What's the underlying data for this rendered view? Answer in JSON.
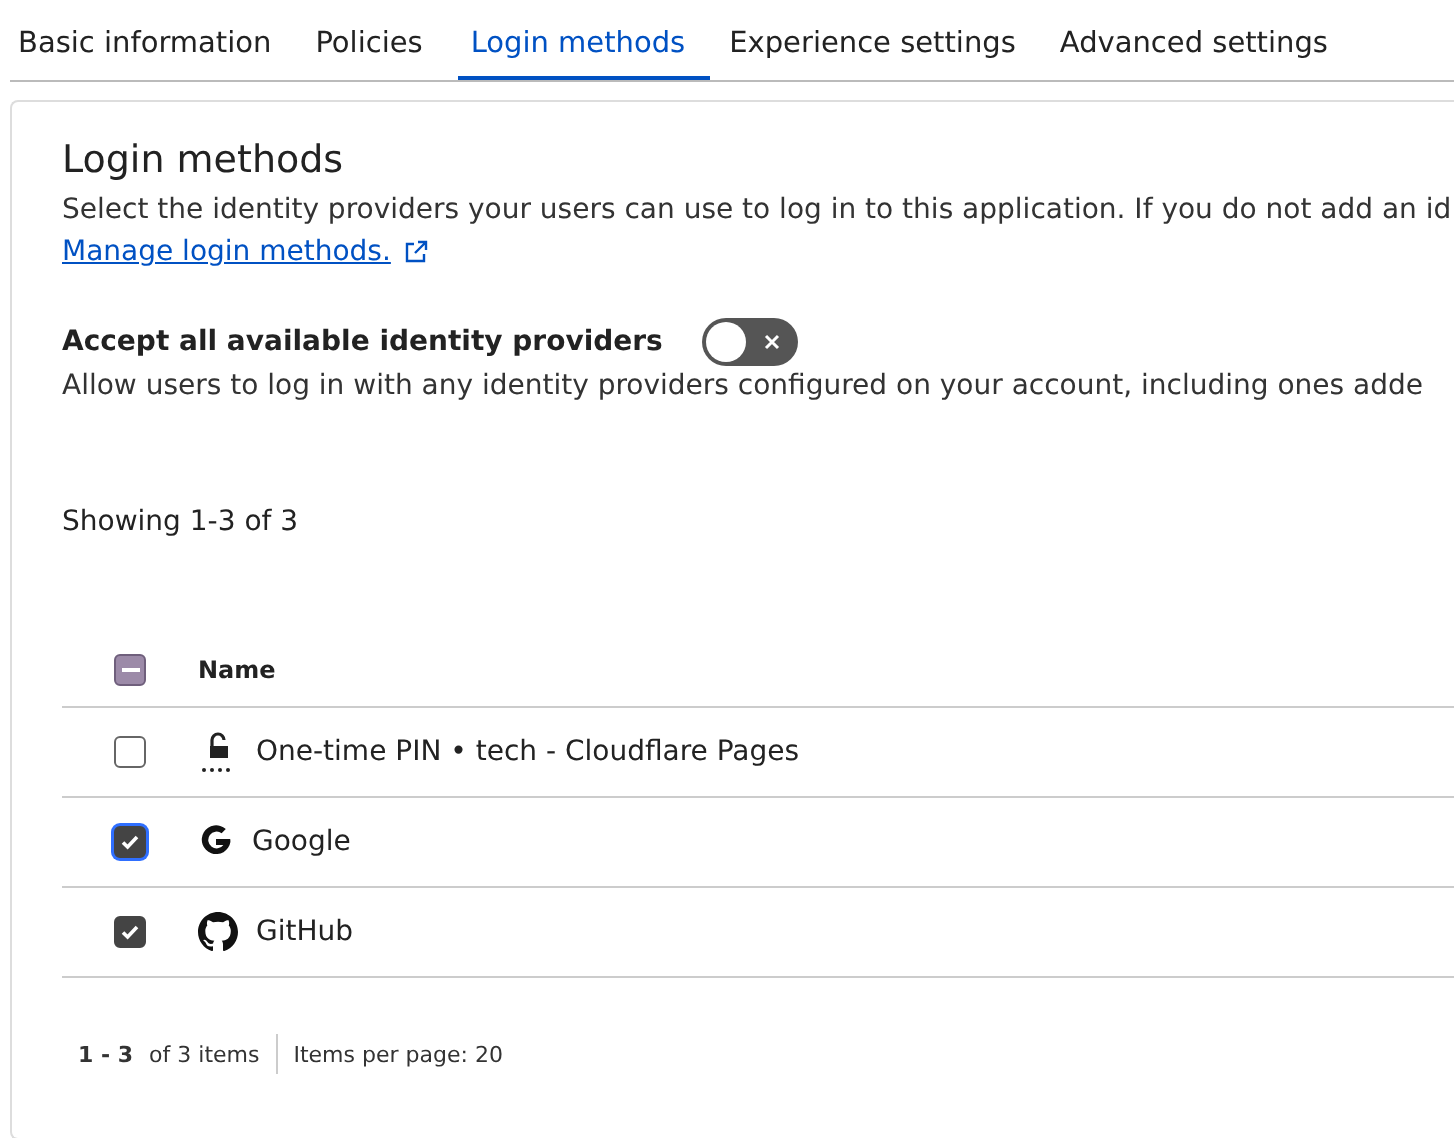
{
  "tabs": [
    {
      "label": "Basic information",
      "selected": false
    },
    {
      "label": "Policies",
      "selected": false
    },
    {
      "label": "Login methods",
      "selected": true
    },
    {
      "label": "Experience settings",
      "selected": false
    },
    {
      "label": "Advanced settings",
      "selected": false
    }
  ],
  "section": {
    "title": "Login methods",
    "description": "Select the identity providers your users can use to log in to this application. If you do not add an id",
    "link": "Manage login methods."
  },
  "accept_all": {
    "label": "Accept all available identity providers",
    "on": false,
    "description": "Allow users to log in with any identity providers configured on your account, including ones adde"
  },
  "showing": "Showing 1-3 of 3",
  "table": {
    "header_checkbox": {
      "indeterminate": true
    },
    "columns": [
      "Name"
    ],
    "rows": [
      {
        "kind": "pin",
        "name": "One-time PIN • tech - Cloudflare Pages",
        "checked": false
      },
      {
        "kind": "google",
        "name": "Google",
        "checked": true
      },
      {
        "kind": "github",
        "name": "GitHub",
        "checked": true
      }
    ]
  },
  "pagination": {
    "range": "1 - 3",
    "total": "of 3 items",
    "per_page": "Items per page: 20"
  }
}
